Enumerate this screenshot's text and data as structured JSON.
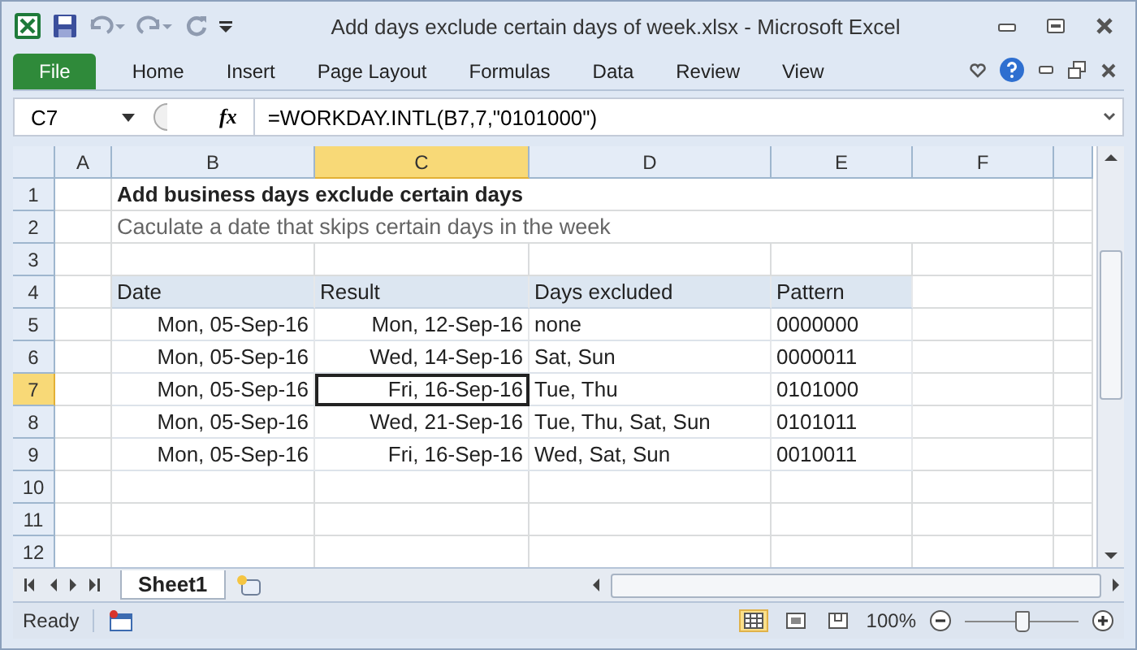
{
  "window": {
    "title": "Add days exclude certain days of week.xlsx  -  Microsoft Excel"
  },
  "ribbon": {
    "tabs": [
      {
        "label": "File",
        "kind": "file",
        "selected": false
      },
      {
        "label": "Home",
        "kind": "tab",
        "selected": false
      },
      {
        "label": "Insert",
        "kind": "tab",
        "selected": false
      },
      {
        "label": "Page Layout",
        "kind": "tab",
        "selected": false
      },
      {
        "label": "Formulas",
        "kind": "tab",
        "selected": false
      },
      {
        "label": "Data",
        "kind": "tab",
        "selected": false
      },
      {
        "label": "Review",
        "kind": "tab",
        "selected": false
      },
      {
        "label": "View",
        "kind": "tab",
        "selected": false
      }
    ]
  },
  "formula_bar": {
    "name_box": "C7",
    "fx": "fx",
    "formula": "=WORKDAY.INTL(B7,7,\"0101000\")"
  },
  "sheet": {
    "columns": [
      {
        "label": "A",
        "selected": false
      },
      {
        "label": "B",
        "selected": false
      },
      {
        "label": "C",
        "selected": true
      },
      {
        "label": "D",
        "selected": false
      },
      {
        "label": "E",
        "selected": false
      },
      {
        "label": "F",
        "selected": false
      }
    ],
    "rows": [
      {
        "number": "1",
        "selected": false,
        "kind": "title",
        "text": "Add business days exclude certain days"
      },
      {
        "number": "2",
        "selected": false,
        "kind": "subtitle",
        "text": "Caculate a date that skips certain days in the week"
      },
      {
        "number": "3",
        "selected": false,
        "kind": "empty"
      },
      {
        "number": "4",
        "selected": false,
        "kind": "header",
        "cells": [
          {
            "text": "Date",
            "active": false
          },
          {
            "text": "Result",
            "active": false
          },
          {
            "text": "Days excluded",
            "active": false
          },
          {
            "text": "Pattern",
            "active": false
          }
        ]
      },
      {
        "number": "5",
        "selected": false,
        "kind": "data",
        "cells": [
          {
            "text": "Mon, 05-Sep-16",
            "active": false
          },
          {
            "text": "Mon, 12-Sep-16",
            "active": false
          },
          {
            "text": "none",
            "active": false
          },
          {
            "text": "0000000",
            "active": false
          }
        ]
      },
      {
        "number": "6",
        "selected": false,
        "kind": "data",
        "cells": [
          {
            "text": "Mon, 05-Sep-16",
            "active": false
          },
          {
            "text": "Wed, 14-Sep-16",
            "active": false
          },
          {
            "text": "Sat, Sun",
            "active": false
          },
          {
            "text": "0000011",
            "active": false
          }
        ]
      },
      {
        "number": "7",
        "selected": true,
        "kind": "data",
        "cells": [
          {
            "text": "Mon, 05-Sep-16",
            "active": false
          },
          {
            "text": "Fri, 16-Sep-16",
            "active": true
          },
          {
            "text": "Tue, Thu",
            "active": false
          },
          {
            "text": "0101000",
            "active": false
          }
        ]
      },
      {
        "number": "8",
        "selected": false,
        "kind": "data",
        "cells": [
          {
            "text": "Mon, 05-Sep-16",
            "active": false
          },
          {
            "text": "Wed, 21-Sep-16",
            "active": false
          },
          {
            "text": "Tue, Thu, Sat, Sun",
            "active": false
          },
          {
            "text": "0101011",
            "active": false
          }
        ]
      },
      {
        "number": "9",
        "selected": false,
        "kind": "data",
        "cells": [
          {
            "text": "Mon, 05-Sep-16",
            "active": false
          },
          {
            "text": "Fri, 16-Sep-16",
            "active": false
          },
          {
            "text": "Wed, Sat, Sun",
            "active": false
          },
          {
            "text": "0010011",
            "active": false
          }
        ]
      },
      {
        "number": "10",
        "selected": false,
        "kind": "empty"
      },
      {
        "number": "11",
        "selected": false,
        "kind": "empty"
      },
      {
        "number": "12",
        "selected": false,
        "kind": "empty"
      }
    ]
  },
  "sheet_tabs": [
    {
      "label": "Sheet1",
      "selected": true
    }
  ],
  "status_bar": {
    "status": "Ready",
    "views": [
      {
        "kind": "normal",
        "selected": true
      },
      {
        "kind": "page-layout",
        "selected": false
      },
      {
        "kind": "page-break",
        "selected": false
      }
    ],
    "zoom": "100%",
    "zoom_slider": {
      "level": 0.5
    }
  }
}
